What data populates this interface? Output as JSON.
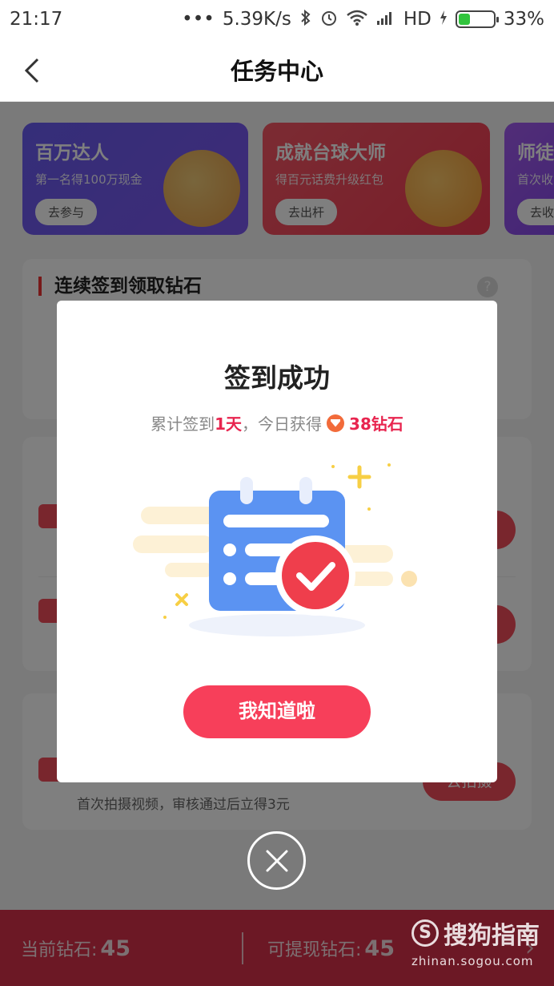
{
  "status_bar": {
    "time": "21:17",
    "dots": "•••",
    "speed": "5.39K/s",
    "network": "HD",
    "battery": "33%",
    "battery_level": 0.33
  },
  "header": {
    "back_glyph": "〈",
    "title": "任务中心"
  },
  "banners": [
    {
      "title": "百万达人",
      "subtitle": "第一名得100万现金",
      "button": "去参与"
    },
    {
      "title": "成就台球大师",
      "subtitle": "得百元话费升级红包",
      "button": "去出杆"
    },
    {
      "title": "师徒",
      "subtitle": "首次收",
      "button": "去收"
    }
  ],
  "signin_card": {
    "title": "连续签到领取钻石",
    "help": "?"
  },
  "task_card_bottom": {
    "description": "首次拍摄视频，审核通过后立得3元",
    "button": "去拍摄"
  },
  "modal": {
    "title": "签到成功",
    "sub_prefix": "累计签到",
    "sub_days": "1天",
    "sub_middle": "，今日获得",
    "sub_reward": "38钻石",
    "confirm": "我知道啦"
  },
  "bottom_bar": {
    "current_label": "当前钻石:",
    "current_value": "45",
    "withdraw_label": "可提现钻石:",
    "withdraw_value": "45",
    "chevron": "›"
  },
  "watermark": {
    "logo_char": "S",
    "logo_text": "搜狗指南",
    "url": "zhinan.sogou.com"
  },
  "colors": {
    "accent_red": "#f73f5a",
    "highlight": "#e8254f",
    "calendar_blue": "#4f8ef7",
    "banner_purple": "#6a5cf2"
  }
}
